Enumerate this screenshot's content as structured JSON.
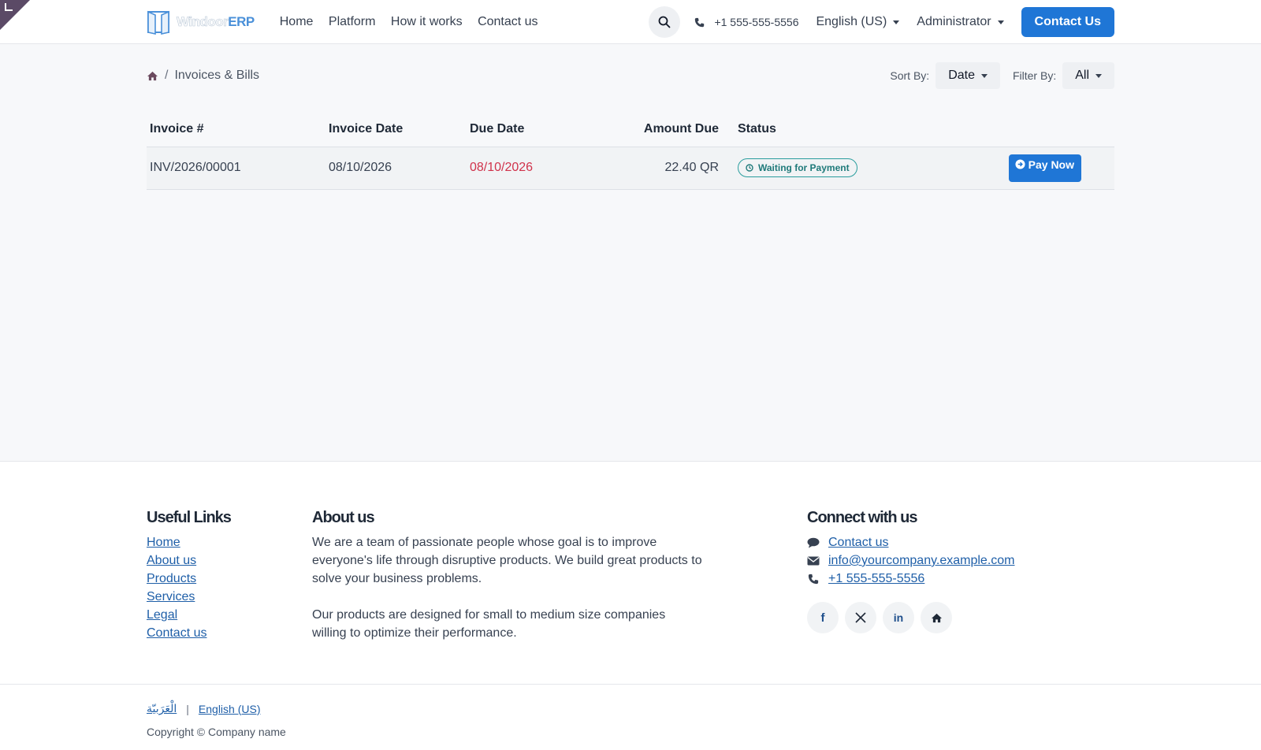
{
  "brand": {
    "logo_part1": "Windoor",
    "logo_part2": "ERP"
  },
  "nav": {
    "items": [
      {
        "label": "Home"
      },
      {
        "label": "Platform"
      },
      {
        "label": "How it works"
      },
      {
        "label": "Contact us"
      }
    ],
    "phone": "+1 555-555-5556",
    "language": "English (US)",
    "user": "Administrator",
    "cta": "Contact Us"
  },
  "breadcrumb": {
    "current": "Invoices & Bills"
  },
  "toolbar": {
    "sort_label": "Sort By:",
    "sort_value": "Date",
    "filter_label": "Filter By:",
    "filter_value": "All"
  },
  "table": {
    "headers": [
      "Invoice #",
      "Invoice Date",
      "Due Date",
      "Amount Due",
      "Status"
    ],
    "rows": [
      {
        "invoice": "INV/2026/00001",
        "invoice_date": "08/10/2026",
        "due_date": "08/10/2026",
        "amount": "22.40 QR",
        "status": "Waiting for Payment",
        "action": "Pay Now"
      }
    ]
  },
  "footer": {
    "useful_links": {
      "title": "Useful Links",
      "links": [
        "Home",
        "About us",
        "Products",
        "Services",
        "Legal",
        "Contact us"
      ]
    },
    "about": {
      "title": "About us",
      "p1": "We are a team of passionate people whose goal is to improve everyone's life through disruptive products. We build great products to solve your business problems.",
      "p2": "Our products are designed for small to medium size companies willing to optimize their performance."
    },
    "connect": {
      "title": "Connect with us",
      "contact": "Contact us",
      "email": "info@yourcompany.example.com",
      "phone": "+1 555-555-5556"
    },
    "languages": [
      "الْعَرَبيّة",
      "English (US)"
    ],
    "copyright": "Copyright © Company name"
  },
  "colors": {
    "primary": "#1f76d6",
    "overdue": "#d0324b",
    "status": "#2a9d9d",
    "corner": "#5b4a66"
  }
}
